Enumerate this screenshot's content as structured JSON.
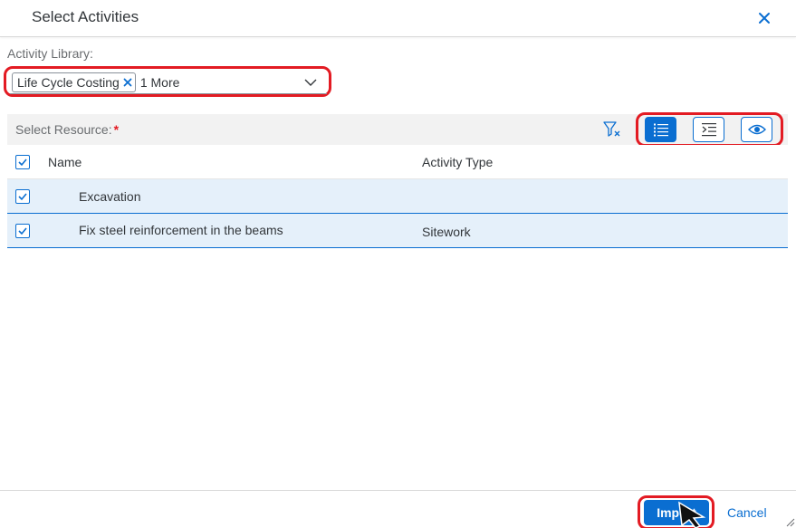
{
  "dialog": {
    "title": "Select Activities",
    "close_icon": "close-icon"
  },
  "library": {
    "label": "Activity Library:",
    "tokens": [
      "Life Cycle Costing"
    ],
    "more_label": "1 More",
    "dropdown_icon": "chevron-down-icon"
  },
  "resource": {
    "label": "Select Resource:",
    "required_marker": "*",
    "toolbar_icons": [
      "filter-clear-icon",
      "list-view-icon",
      "indent-view-icon",
      "show-icon"
    ]
  },
  "table": {
    "columns": [
      "Name",
      "Activity Type"
    ],
    "header_checked": true,
    "rows": [
      {
        "name": "Excavation",
        "activity_type": "",
        "checked": true
      },
      {
        "name": "Fix steel reinforcement in the beams",
        "activity_type": "Sitework",
        "checked": true
      }
    ]
  },
  "footer": {
    "import_label": "Import",
    "cancel_label": "Cancel"
  },
  "colors": {
    "accent": "#0a6ed1",
    "highlight_outline": "#e31b23",
    "selected_row": "#e5f0fa"
  }
}
